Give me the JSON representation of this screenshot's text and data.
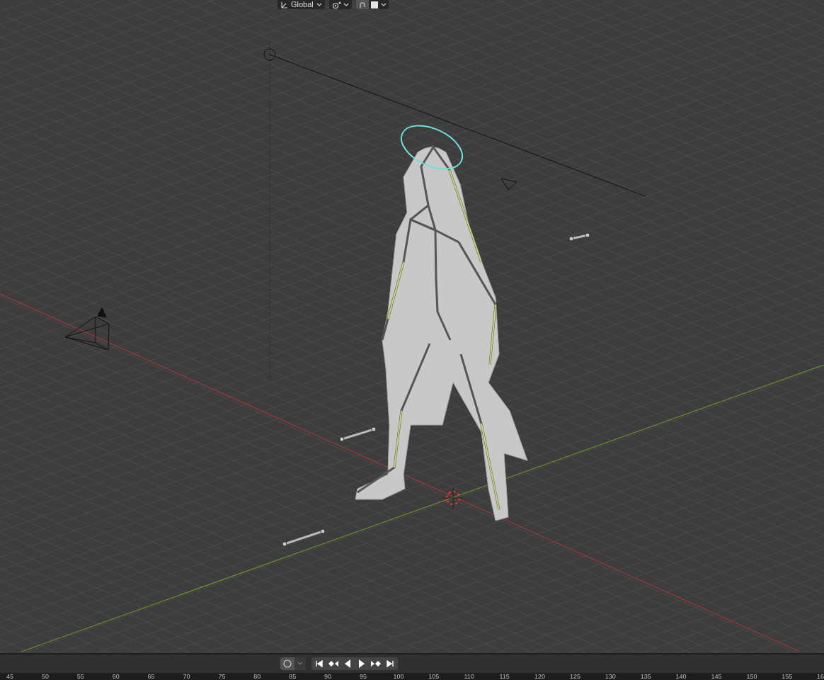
{
  "header": {
    "transform_orientation": "Global",
    "snapping_on": true
  },
  "timeline": {
    "auto_keying_on": false,
    "frame_numbers": [
      "45",
      "50",
      "55",
      "60",
      "65",
      "70",
      "75",
      "80",
      "85",
      "90",
      "95",
      "100",
      "105",
      "110",
      "115",
      "120",
      "125",
      "130",
      "135",
      "140",
      "145",
      "150",
      "155",
      "16"
    ]
  }
}
